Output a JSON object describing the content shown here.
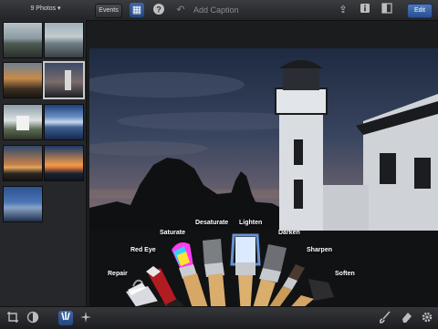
{
  "topbar": {
    "photos_label": "9 Photos ▾",
    "events_label": "Events",
    "caption_placeholder": "Add Caption",
    "edit_label": "Edit",
    "icons": [
      "grid-icon",
      "help-icon",
      "undo-icon",
      "share-icon",
      "info-icon",
      "compare-icon"
    ]
  },
  "brushes": {
    "labels": {
      "repair": "Repair",
      "red_eye": "Red Eye",
      "saturate": "Saturate",
      "desaturate": "Desaturate",
      "lighten": "Lighten",
      "darken": "Darken",
      "sharpen": "Sharpen",
      "soften": "Soften"
    },
    "active": "lighten"
  },
  "bottombar": {
    "left_icons": [
      "crop-icon",
      "exposure-icon",
      "brushes-icon",
      "effects-icon"
    ],
    "right_icons": [
      "paint-brush-icon",
      "eraser-icon",
      "settings-icon"
    ],
    "active_tool": "brushes-icon"
  },
  "colors": {
    "accent": "#2f5aa0",
    "bar_dark": "#232427"
  }
}
